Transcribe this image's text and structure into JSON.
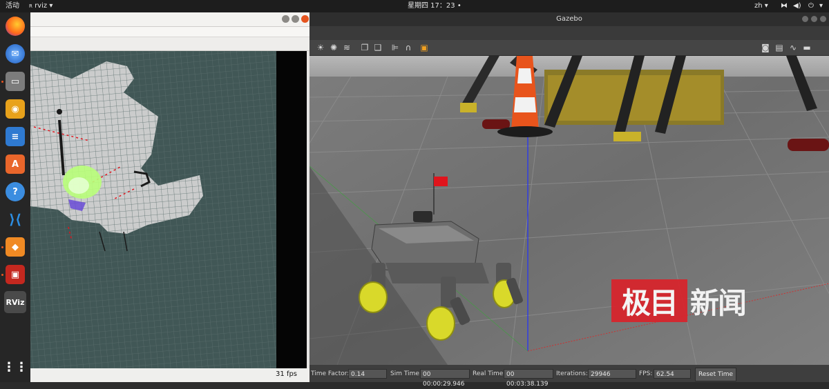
{
  "topbar": {
    "activities": "活动",
    "app_menu": "rviz",
    "clock": "星期四 17：23",
    "input_method": "zh"
  },
  "dock": {
    "items": [
      "firefox-icon",
      "thunderbird-icon",
      "files-icon",
      "rhythmbox-icon",
      "writer-icon",
      "software-icon",
      "help-icon",
      "vscode-icon",
      "sublime-icon",
      "terminal-icon",
      "rviz-icon",
      "apps-grid-icon"
    ],
    "rviz_label": "RViz"
  },
  "rviz": {
    "fps": "31 fps"
  },
  "gazebo": {
    "title": "Gazebo",
    "bottom": {
      "time_factor_label": "Time Factor:",
      "time_factor": "0.14",
      "sim_time_label": "Sim Time:",
      "sim_time": "00 00:00:29.946",
      "real_time_label": "Real Time:",
      "real_time": "00 00:03:38.139",
      "iterations_label": "Iterations:",
      "iterations": "29946",
      "fps_label": "FPS:",
      "fps": "62.54",
      "reset_label": "Reset Time"
    }
  },
  "watermark": {
    "boxed": "极目",
    "text": "新闻"
  },
  "colors": {
    "accent": "#e95420",
    "flag": "#e0141c",
    "wheel": "#d9d92a",
    "cone": "#e8541c",
    "map_bg": "#415756",
    "laser": "#b9ff7a"
  }
}
